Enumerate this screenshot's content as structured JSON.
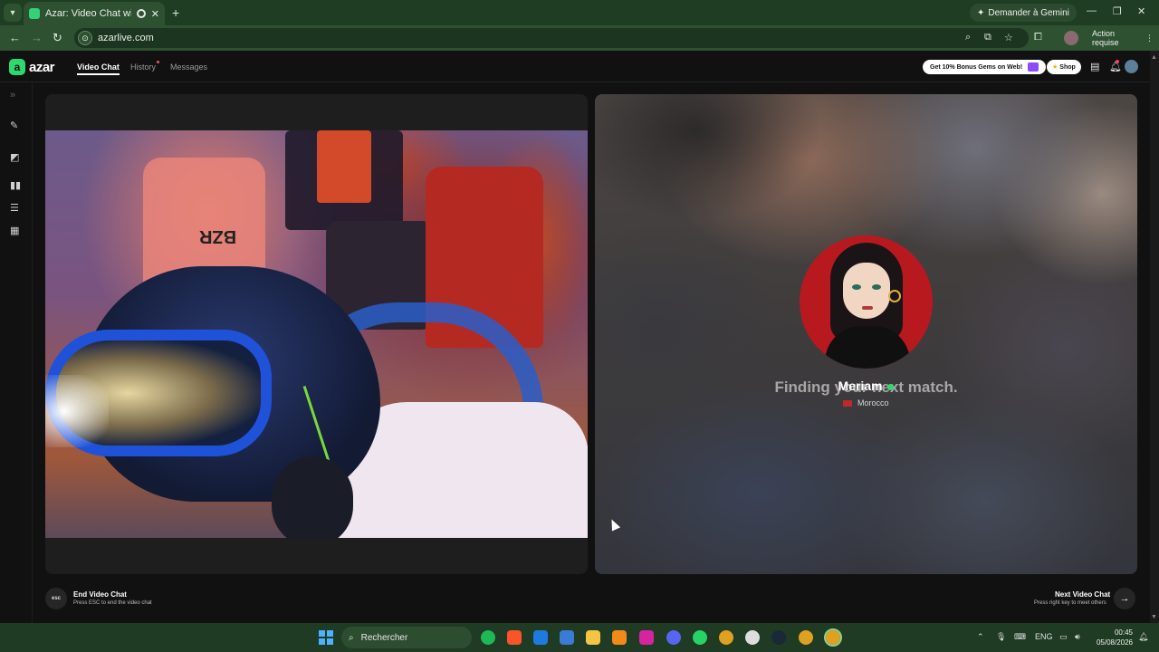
{
  "browser": {
    "tab_title": "Azar: Video Chat with New",
    "url": "azarlive.com",
    "gemini_button": "Demander à Gemini",
    "action_button": "Action requise"
  },
  "app": {
    "logo_text": "azar",
    "nav": [
      {
        "label": "Video Chat",
        "active": true
      },
      {
        "label": "History",
        "active": false,
        "has_dot": true
      },
      {
        "label": "Messages",
        "active": false
      }
    ],
    "promo_label": "Get 10% Bonus Gems on Web!",
    "shop_label": "Shop"
  },
  "self_video": {
    "shirt_print": "BZR"
  },
  "match": {
    "status_text": "Finding your next match.",
    "name": "Meriam",
    "country": "Morocco"
  },
  "controls": {
    "end_key": "esc",
    "end_title": "End Video Chat",
    "end_subtitle": "Press ESC to end the video chat",
    "next_title": "Next Video Chat",
    "next_subtitle": "Press right key to meet others"
  },
  "taskbar": {
    "search_placeholder": "Rechercher",
    "language": "ENG",
    "time": "00:45",
    "date": "05/08/2026"
  },
  "colors": {
    "brand_green": "#2dd96e",
    "chrome_green": "#2e5131",
    "page_bg": "#111111"
  }
}
